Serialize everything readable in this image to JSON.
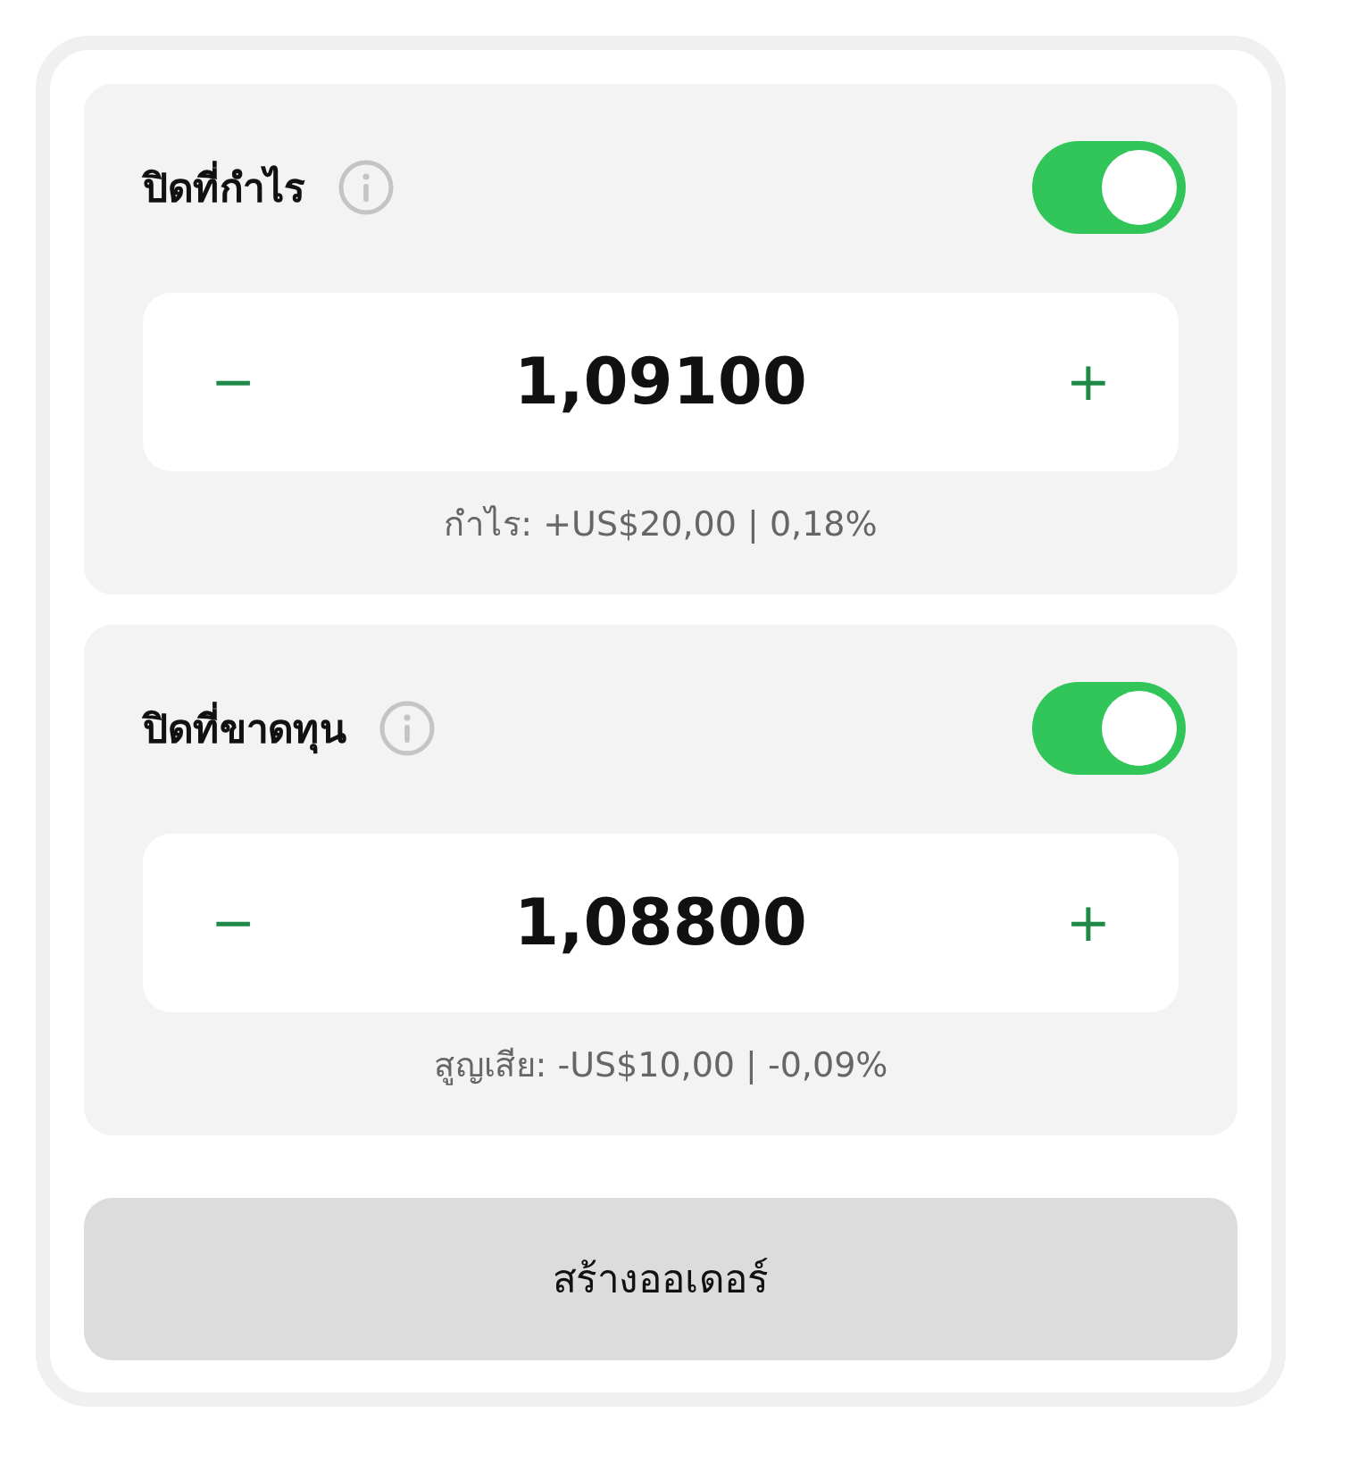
{
  "sections": [
    {
      "title": "ปิดที่กำไร",
      "toggle_on": true,
      "minus": "−",
      "value": "1,09100",
      "plus": "+",
      "summary": "กำไร: +US$20,00 | 0,18%"
    },
    {
      "title": "ปิดที่ขาดทุน",
      "toggle_on": true,
      "minus": "−",
      "value": "1,08800",
      "plus": "+",
      "summary": "สูญเสีย: -US$10,00 | -0,09%"
    }
  ],
  "submit_button": "สร้างออเดอร์"
}
